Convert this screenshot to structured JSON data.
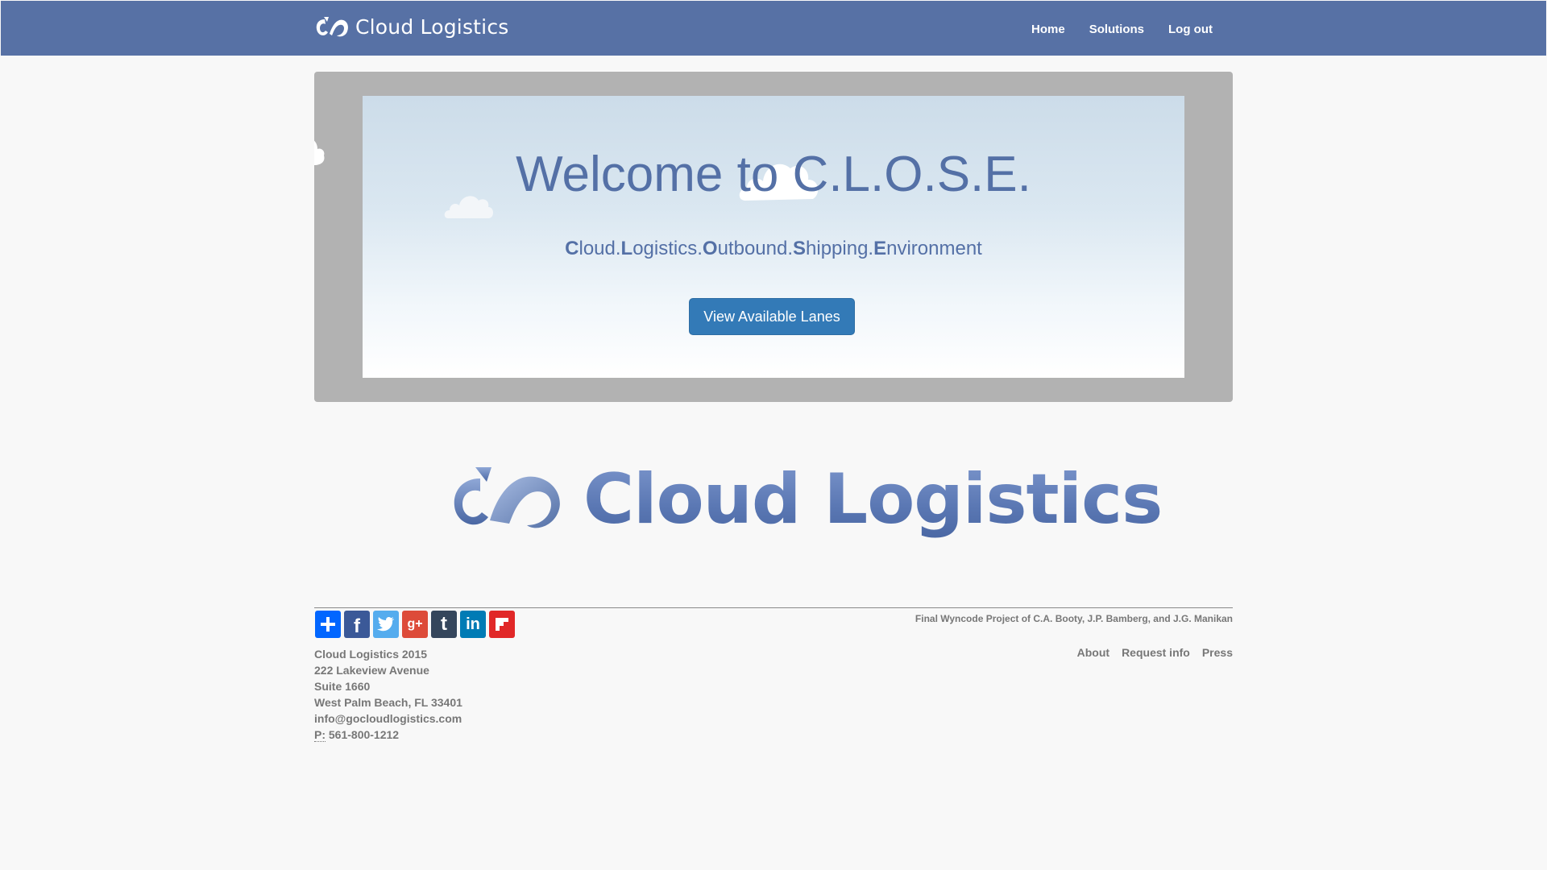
{
  "colors": {
    "navbar": "#5771a5",
    "brand_blue": "#5470a6",
    "button": "#337ab7",
    "footer_text": "#777777"
  },
  "navbar": {
    "brand": "Cloud Logistics",
    "links": [
      "Home",
      "Solutions",
      "Log out"
    ]
  },
  "hero": {
    "title": "Welcome to C.L.O.S.E.",
    "subtitle": [
      {
        "bold": "C",
        "rest": "loud."
      },
      {
        "bold": "L",
        "rest": "ogistics."
      },
      {
        "bold": "O",
        "rest": "utbound."
      },
      {
        "bold": "S",
        "rest": "hipping."
      },
      {
        "bold": "E",
        "rest": "nvironment"
      }
    ],
    "button": "View Available Lanes"
  },
  "logo": {
    "text": "Cloud Logistics",
    "icon": "cloud-logistics-logo-icon"
  },
  "footer": {
    "share_icons": [
      "share-plus-icon",
      "facebook-icon",
      "twitter-icon",
      "google-plus-icon",
      "tumblr-icon",
      "linkedin-icon",
      "flipboard-icon"
    ],
    "credit": "Final Wyncode Project of C.A. Booty, J.P. Bamberg, and J.G. Manikan",
    "address": {
      "company": "Cloud Logistics 2015",
      "street": "222 Lakeview Avenue",
      "suite": "Suite 1660",
      "city": "West Palm Beach, FL 33401",
      "email": "info@gocloudlogistics.com",
      "phone_label": "P:",
      "phone": "561-800-1212"
    },
    "links": [
      "About",
      "Request info",
      "Press"
    ]
  }
}
